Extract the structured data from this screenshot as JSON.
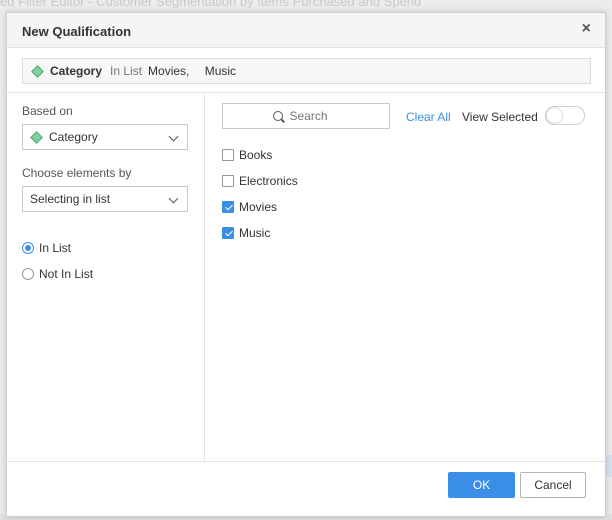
{
  "background": {
    "title": "ed Filter Editor - Customer Segmentation by Items Purchased and Spend"
  },
  "dialog": {
    "title": "New Qualification",
    "close_icon": "close-icon",
    "summary": {
      "attribute": "Category",
      "operator": "In List",
      "values": [
        "Movies,",
        "Music"
      ]
    },
    "left": {
      "based_on_label": "Based on",
      "based_on_value": "Category",
      "choose_label": "Choose elements by",
      "choose_value": "Selecting in list",
      "radio_in_list": "In List",
      "radio_not_in_list": "Not In List",
      "selected_radio": "In List"
    },
    "right": {
      "search_placeholder": "Search",
      "clear_all": "Clear All",
      "view_selected": "View Selected",
      "view_selected_on": false,
      "items": [
        {
          "label": "Books",
          "checked": false
        },
        {
          "label": "Electronics",
          "checked": false
        },
        {
          "label": "Movies",
          "checked": true
        },
        {
          "label": "Music",
          "checked": true
        }
      ]
    },
    "footer": {
      "ok": "OK",
      "cancel": "Cancel"
    }
  },
  "colors": {
    "accent": "#3b8ee6",
    "attribute_icon": "#7fcf9e"
  }
}
